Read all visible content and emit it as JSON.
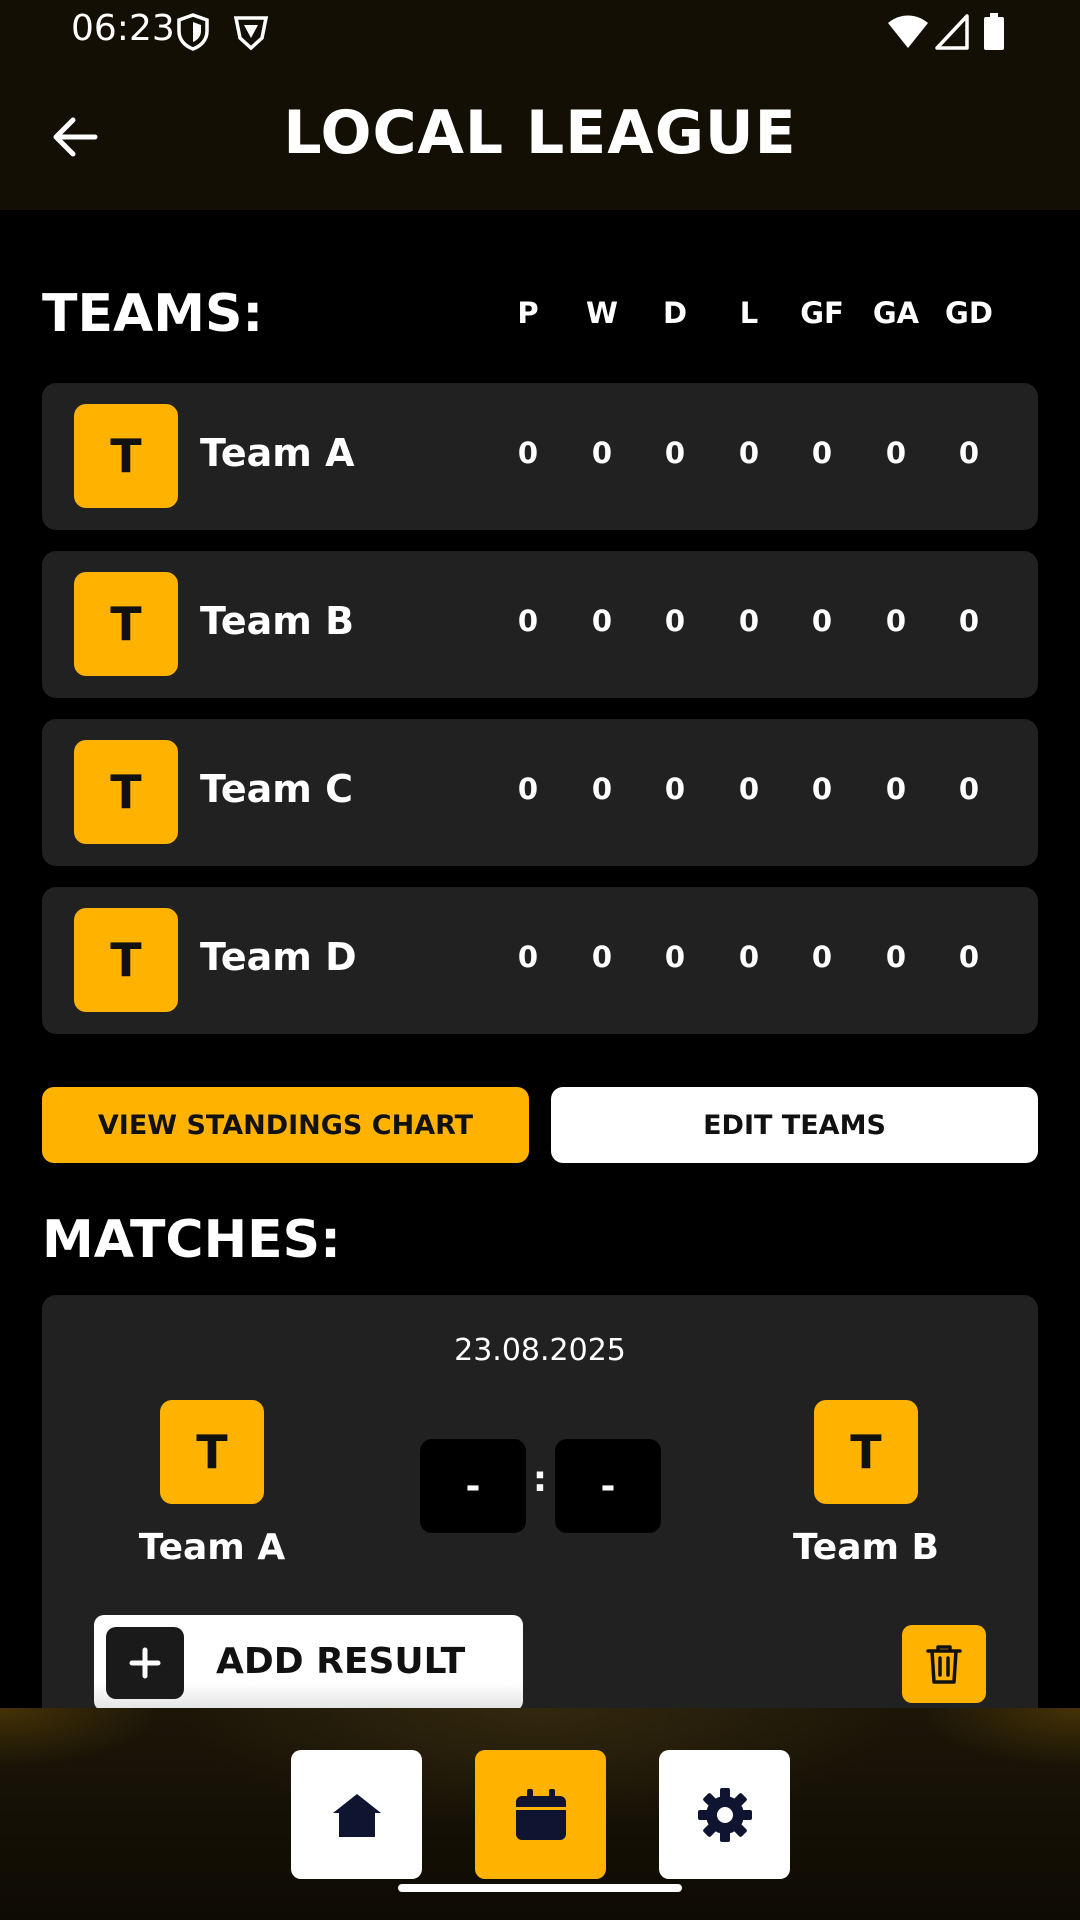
{
  "status_bar": {
    "time": "06:23",
    "left_icons": [
      "shield-icon",
      "vpn-icon"
    ],
    "right_icons": [
      "wifi-icon",
      "signal-icon",
      "battery-icon"
    ]
  },
  "app_bar": {
    "title": "LOCAL LEAGUE",
    "back_icon": "arrow-left-icon"
  },
  "teams": {
    "heading": "TEAMS:",
    "columns": [
      "P",
      "W",
      "D",
      "L",
      "GF",
      "GA",
      "GD"
    ],
    "rows": [
      {
        "avatar": "T",
        "name": "Team A",
        "stats": [
          "0",
          "0",
          "0",
          "0",
          "0",
          "0",
          "0"
        ]
      },
      {
        "avatar": "T",
        "name": "Team B",
        "stats": [
          "0",
          "0",
          "0",
          "0",
          "0",
          "0",
          "0"
        ]
      },
      {
        "avatar": "T",
        "name": "Team C",
        "stats": [
          "0",
          "0",
          "0",
          "0",
          "0",
          "0",
          "0"
        ]
      },
      {
        "avatar": "T",
        "name": "Team D",
        "stats": [
          "0",
          "0",
          "0",
          "0",
          "0",
          "0",
          "0"
        ]
      }
    ]
  },
  "actions": {
    "standings_label": "VIEW STANDINGS CHART",
    "edit_label": "EDIT TEAMS"
  },
  "matches": {
    "heading": "MATCHES:",
    "items": [
      {
        "date": "23.08.2025",
        "home": {
          "avatar": "T",
          "name": "Team A"
        },
        "away": {
          "avatar": "T",
          "name": "Team B"
        },
        "home_score": "-",
        "away_score": "-",
        "separator": ":",
        "add_result_label": "ADD RESULT"
      }
    ]
  },
  "bottom_nav": {
    "items": [
      {
        "icon": "home-icon",
        "active": false
      },
      {
        "icon": "calendar-icon",
        "active": true
      },
      {
        "icon": "gear-icon",
        "active": false
      }
    ]
  },
  "colors": {
    "accent": "#ffb300",
    "background": "#000000",
    "card": "#212121",
    "header": "#140f05"
  }
}
